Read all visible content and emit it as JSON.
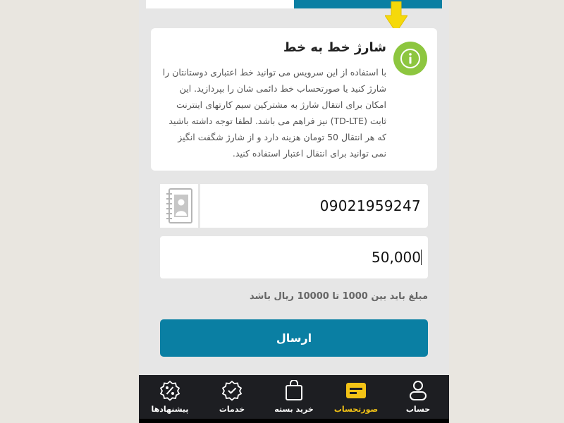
{
  "info": {
    "title": "شارژ خط به خط",
    "body": "با استفاده از این سرویس می توانید خط اعتباری دوستانتان را شارژ کنید یا صورتحساب خط دائمی شان را بپردازید. این امکان برای انتقال شارژ به مشترکین سیم کارتهای اینترنت ثابت (TD-LTE) نیز فراهم می باشد. لطفا توجه داشته باشید که هر انتقال 50 تومان هزینه دارد و از شارژ شگفت انگیز نمی توانید برای انتقال اعتبار استفاده کنید."
  },
  "form": {
    "phone_value": "09021959247",
    "amount_value": "50,000",
    "hint": "مبلغ باید بین 1000 تا 10000 ریال باشد",
    "submit_label": "ارسال"
  },
  "nav": {
    "items": [
      {
        "label": "حساب",
        "icon": "person-icon"
      },
      {
        "label": "صورتحساب",
        "icon": "card-icon",
        "active": true
      },
      {
        "label": "خرید بسته",
        "icon": "bag-icon"
      },
      {
        "label": "خدمات",
        "icon": "check-badge-icon"
      },
      {
        "label": "پیشنهادها",
        "icon": "percent-badge-icon"
      }
    ]
  },
  "colors": {
    "accent": "#0a7fa3",
    "info_green": "#8dc63f",
    "active_nav": "#f3c316",
    "arrow_yellow": "#f5d90a",
    "nav_bg": "#1d1e22"
  }
}
